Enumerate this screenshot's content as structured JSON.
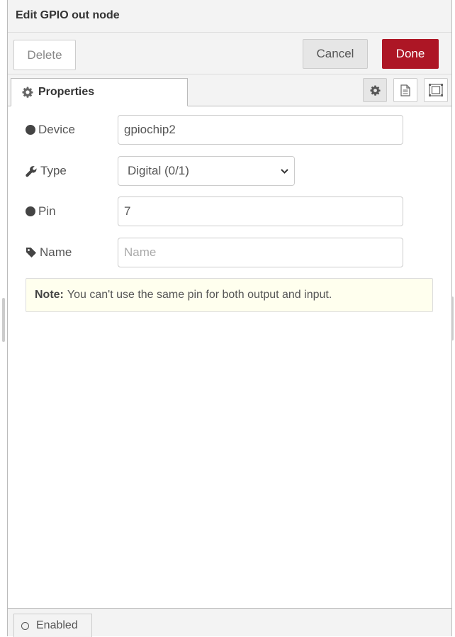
{
  "header": {
    "title": "Edit GPIO out node"
  },
  "toolbar": {
    "delete_label": "Delete",
    "cancel_label": "Cancel",
    "done_label": "Done"
  },
  "tabs": {
    "properties_label": "Properties"
  },
  "form": {
    "device": {
      "label": "Device",
      "value": "gpiochip2"
    },
    "type": {
      "label": "Type",
      "selected": "Digital (0/1)"
    },
    "pin": {
      "label": "Pin",
      "value": "7"
    },
    "name": {
      "label": "Name",
      "value": "",
      "placeholder": "Name"
    }
  },
  "note": {
    "prefix": "Note:",
    "text": "You can't use the same pin for both output and input."
  },
  "footer": {
    "enabled_label": "Enabled"
  },
  "colors": {
    "done_bg": "#ad1625",
    "note_bg": "#ffffee",
    "panel_bg": "#f3f3f3"
  },
  "icons": [
    "gear-icon",
    "description-icon",
    "appearance-icon",
    "wrench-icon",
    "tag-icon",
    "chevron-down-icon",
    "circle-icon"
  ]
}
